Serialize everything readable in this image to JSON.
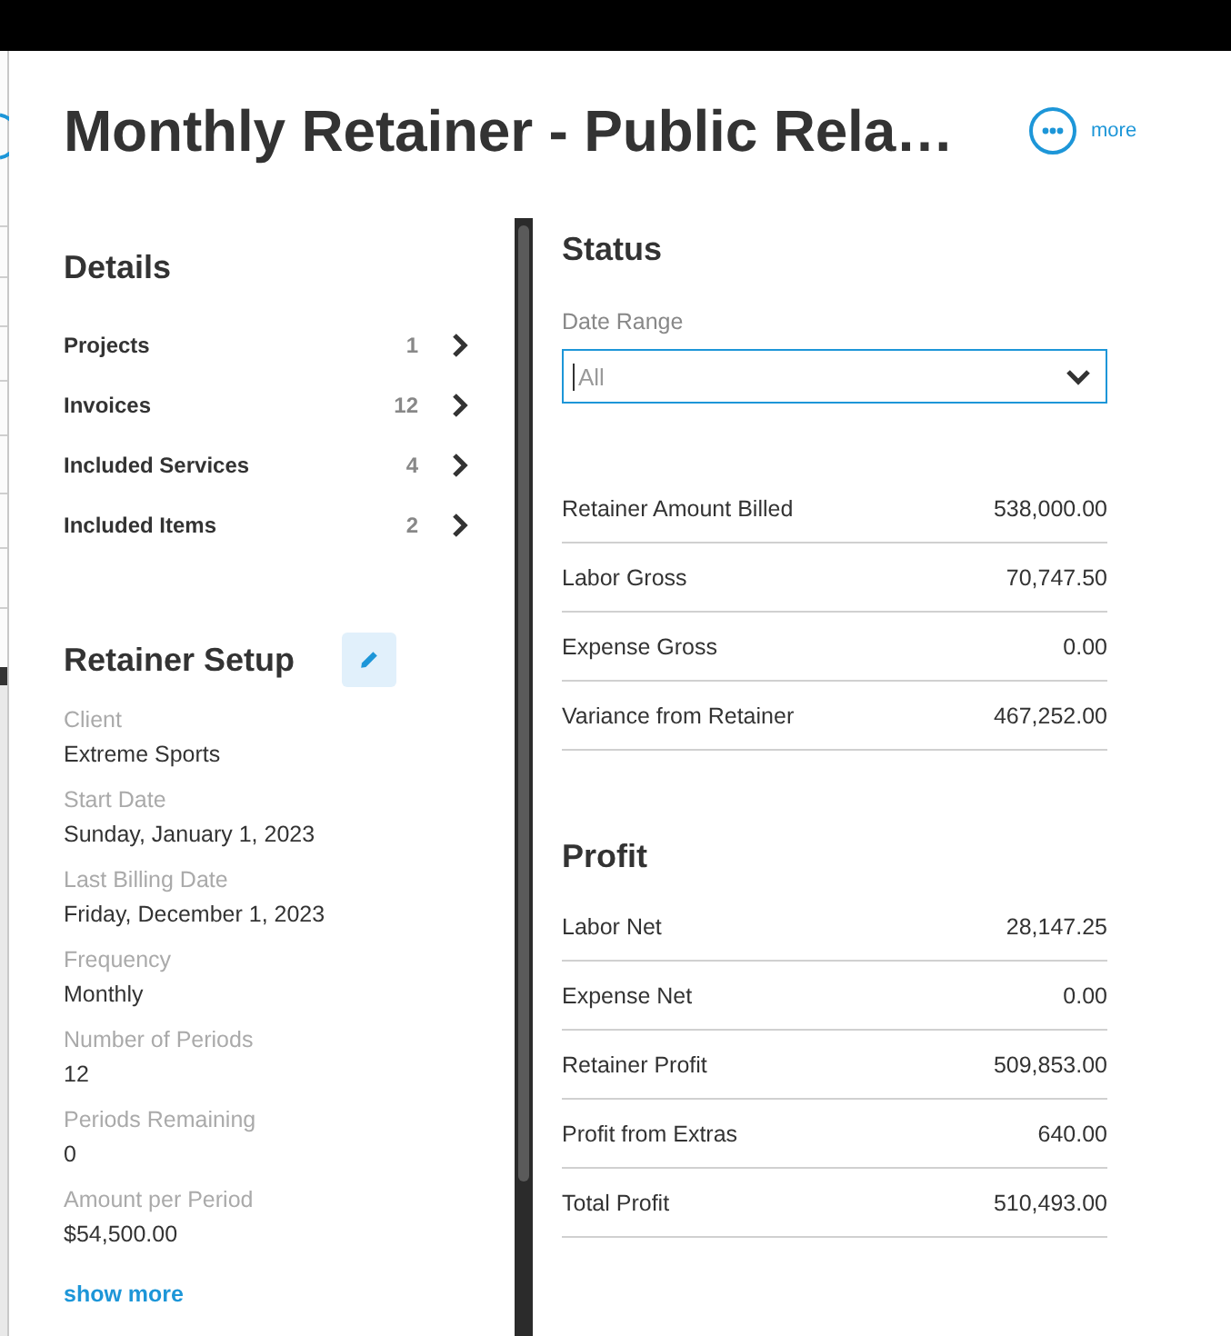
{
  "header": {
    "title": "Monthly Retainer - Public Rela…",
    "more_label": "more"
  },
  "details": {
    "title": "Details",
    "items": [
      {
        "label": "Projects",
        "count": "1"
      },
      {
        "label": "Invoices",
        "count": "12"
      },
      {
        "label": "Included Services",
        "count": "4"
      },
      {
        "label": "Included Items",
        "count": "2"
      }
    ]
  },
  "retainer_setup": {
    "title": "Retainer Setup",
    "fields": [
      {
        "label": "Client",
        "value": "Extreme Sports"
      },
      {
        "label": "Start Date",
        "value": "Sunday, January 1, 2023"
      },
      {
        "label": "Last Billing Date",
        "value": "Friday, December 1, 2023"
      },
      {
        "label": "Frequency",
        "value": "Monthly"
      },
      {
        "label": "Number of Periods",
        "value": "12"
      },
      {
        "label": "Periods Remaining",
        "value": "0"
      },
      {
        "label": "Amount per Period",
        "value": "$54,500.00"
      }
    ],
    "show_more": "show more"
  },
  "status": {
    "title": "Status",
    "date_range": {
      "label": "Date Range",
      "placeholder": "All"
    },
    "rows": [
      {
        "label": "Retainer Amount Billed",
        "value": "538,000.00"
      },
      {
        "label": "Labor Gross",
        "value": "70,747.50"
      },
      {
        "label": "Expense Gross",
        "value": "0.00"
      },
      {
        "label": "Variance from Retainer",
        "value": "467,252.00"
      }
    ]
  },
  "profit": {
    "title": "Profit",
    "rows": [
      {
        "label": "Labor Net",
        "value": "28,147.25"
      },
      {
        "label": "Expense Net",
        "value": "0.00"
      },
      {
        "label": "Retainer Profit",
        "value": "509,853.00"
      },
      {
        "label": "Profit from Extras",
        "value": "640.00"
      },
      {
        "label": "Total Profit",
        "value": "510,493.00"
      }
    ]
  }
}
